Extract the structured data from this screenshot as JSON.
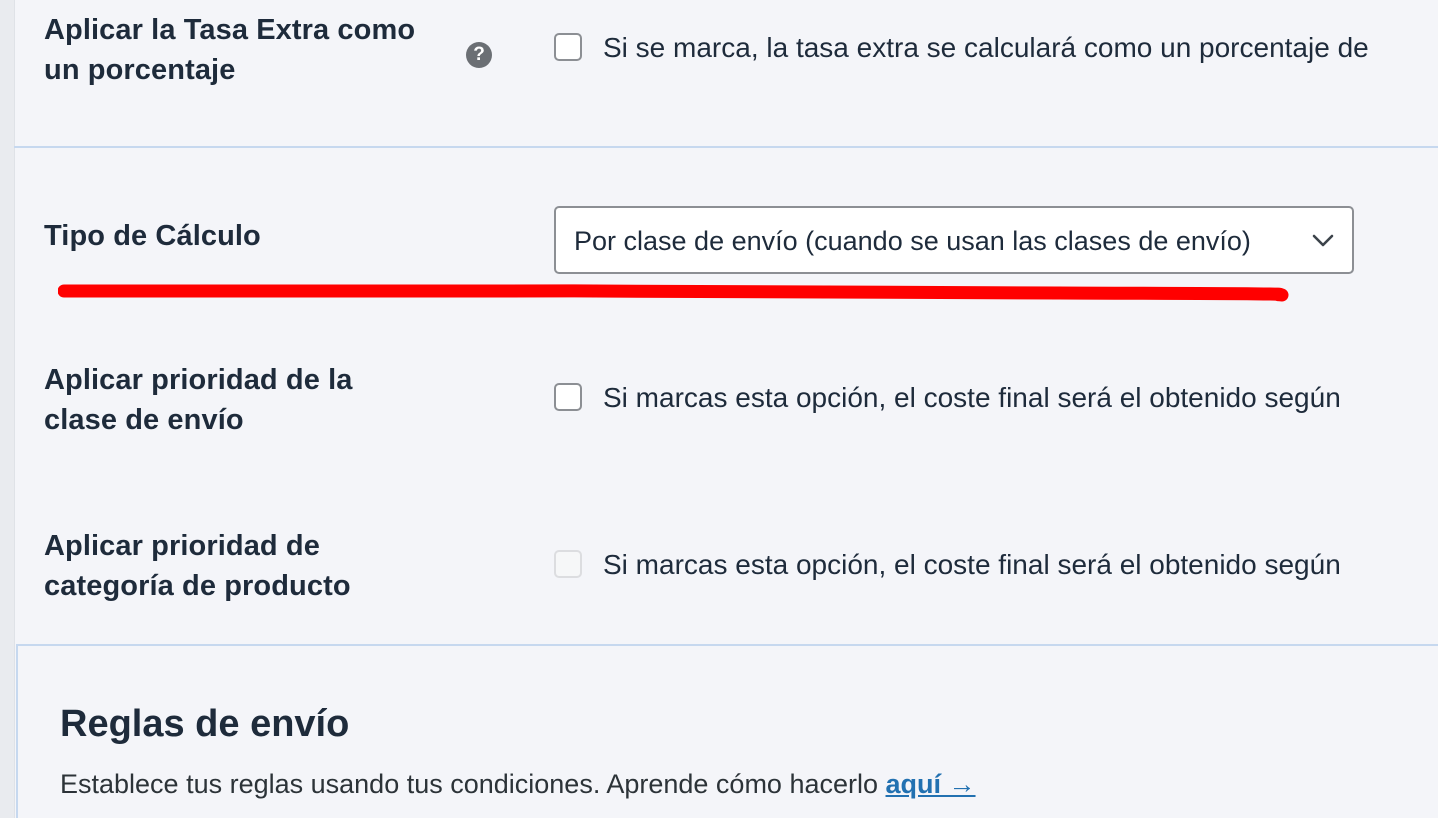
{
  "settings": {
    "extra_fee_percent": {
      "label_line1": "Aplicar la Tasa Extra como",
      "label_line2": "un porcentaje",
      "help_icon": "help-icon",
      "help_glyph": "?",
      "description": "Si se marca, la tasa extra se calculará como un porcentaje de"
    },
    "calculation_type": {
      "label": "Tipo de Cálculo",
      "selected_value": "Por clase de envío (cuando se usan las clases de envío)",
      "chevron_icon": "chevron-down-icon",
      "highlight_color": "#ff0000"
    },
    "shipping_class_priority": {
      "label_line1": "Aplicar prioridad de la",
      "label_line2": "clase de envío",
      "description": "Si marcas esta opción, el coste final será el obtenido según"
    },
    "product_category_priority": {
      "label_line1": "Aplicar prioridad de",
      "label_line2": "categoría de producto",
      "description": "Si marcas esta opción, el coste final será el obtenido según"
    }
  },
  "rules": {
    "title": "Reglas de envío",
    "text": "Establece tus reglas usando tus condiciones. Aprende cómo hacerlo ",
    "link": "aquí →"
  },
  "colors": {
    "background": "#f4f5f9",
    "text": "#1e2b3b",
    "link": "#2271b1",
    "divider": "#c6d8ef"
  }
}
